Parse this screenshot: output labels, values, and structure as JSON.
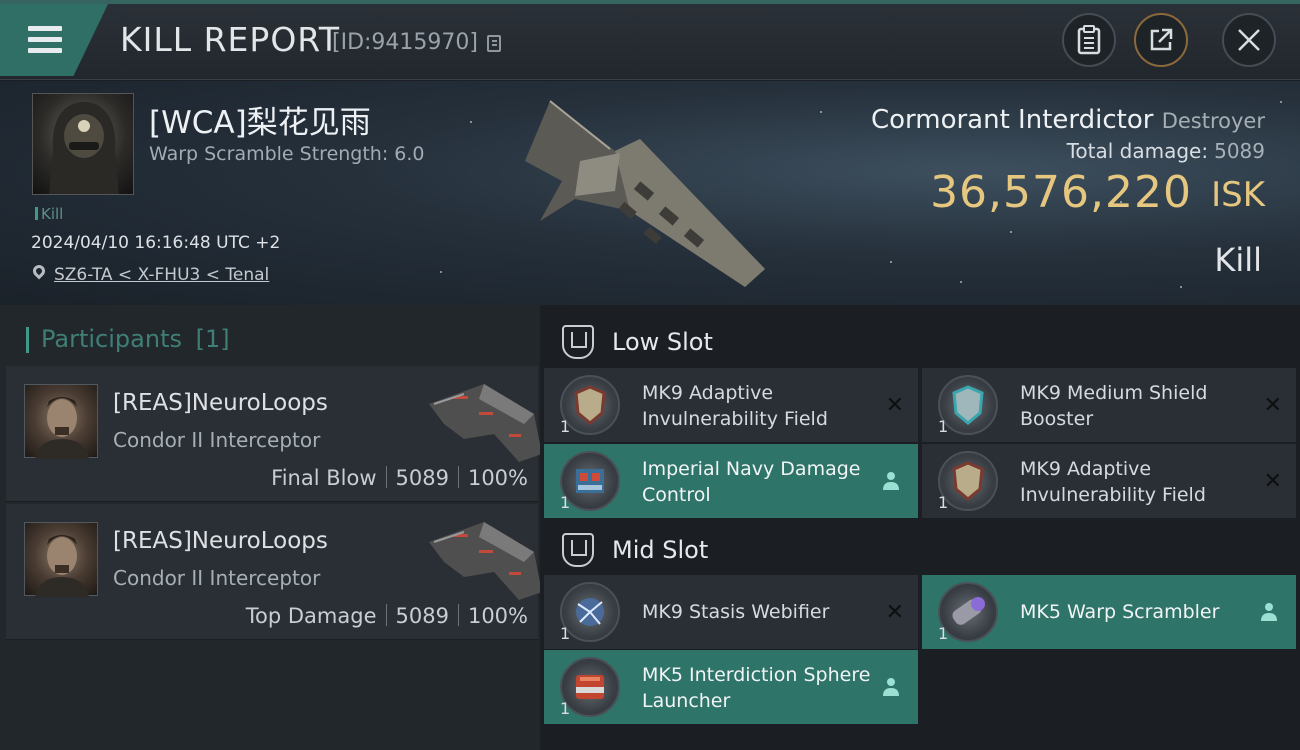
{
  "header": {
    "title": "KILL REPORT",
    "report_id": "[ID:9415970]",
    "icons": [
      "menu-icon",
      "copy-icon",
      "clipboard-icon",
      "share-icon",
      "close-icon"
    ]
  },
  "victim": {
    "pilot_name": "[WCA]梨花见雨",
    "warp_scramble": "Warp Scramble Strength: 6.0",
    "tag": "Kill",
    "datetime": "2024/04/10 16:16:48 UTC +2",
    "location": "SZ6-TA < X-FHU3 < Tenal",
    "ship_name": "Cormorant Interdictor",
    "ship_class": "Destroyer",
    "total_damage_label": "Total damage:",
    "total_damage": "5089",
    "isk_value": "36,576,220",
    "isk_unit": "ISK",
    "result": "Kill"
  },
  "participants": {
    "title": "Participants",
    "count": "[1]",
    "rows": [
      {
        "name": "[REAS]NeuroLoops",
        "ship": "Condor II Interceptor",
        "stat_label": "Final Blow",
        "damage": "5089",
        "percent": "100%"
      },
      {
        "name": "[REAS]NeuroLoops",
        "ship": "Condor II Interceptor",
        "stat_label": "Top Damage",
        "damage": "5089",
        "percent": "100%"
      }
    ]
  },
  "low_slot": {
    "title": "Low Slot",
    "modules": [
      {
        "name": "MK9 Adaptive Invulnerability Field",
        "qty": "1",
        "status": "destroyed"
      },
      {
        "name": "MK9 Medium Shield Booster",
        "qty": "1",
        "status": "destroyed"
      },
      {
        "name": "Imperial Navy Damage Control",
        "qty": "1",
        "status": "dropped"
      },
      {
        "name": "MK9 Adaptive Invulnerability Field",
        "qty": "1",
        "status": "destroyed"
      }
    ]
  },
  "mid_slot": {
    "title": "Mid Slot",
    "modules": [
      {
        "name": "MK9 Stasis Webifier",
        "qty": "1",
        "status": "destroyed"
      },
      {
        "name": "MK5 Warp Scrambler",
        "qty": "1",
        "status": "dropped"
      },
      {
        "name": "MK5 Interdiction Sphere Launcher",
        "qty": "1",
        "status": "dropped"
      }
    ]
  },
  "colors": {
    "accent_teal": "#2f7468",
    "isk_gold": "#e6c77f",
    "panel": "#2a2f35",
    "background": "#1b1f24"
  }
}
